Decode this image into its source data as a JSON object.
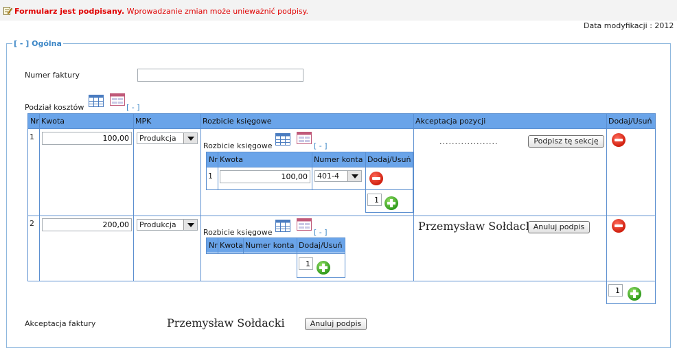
{
  "banner": {
    "bold_text": "Formularz jest podpisany.",
    "text": " Wprowadzanie zmian może unieważnić podpisy."
  },
  "modified_label": "Data modyfikacji : 2012",
  "section": {
    "toggle": "[ - ]",
    "title": "Ogólna"
  },
  "invoice": {
    "label": "Numer faktury",
    "value": ""
  },
  "cost_split": {
    "label": "Podział kosztów",
    "toggle": "[ - ]",
    "columns": [
      "Nr",
      "Kwota",
      "MPK",
      "Rozbicie księgowe",
      "Akceptacja pozycji",
      "Dodaj/Usuń"
    ],
    "rows": [
      {
        "nr": "1",
        "amount": "100,00",
        "mpk": "Produkcja",
        "breakdown": {
          "label": "Rozbicie księgowe",
          "toggle": "[ - ]",
          "columns": [
            "Nr",
            "Kwota",
            "Numer konta",
            "Dodaj/Usuń"
          ],
          "rows": [
            {
              "nr": "1",
              "amount": "100,00",
              "account": "401-4"
            }
          ],
          "add_count": "1"
        },
        "acceptance": {
          "dots": "...................",
          "button": "Podpisz tę sekcję"
        }
      },
      {
        "nr": "2",
        "amount": "200,00",
        "mpk": "Produkcja",
        "breakdown": {
          "label": "Rozbicie księgowe",
          "toggle": "[ - ]",
          "columns": [
            "Nr",
            "Kwota",
            "Numer konta",
            "Dodaj/Usuń"
          ],
          "rows": [],
          "add_count": "1"
        },
        "acceptance": {
          "signature": "Przemysław Sołdacki",
          "button": "Anuluj podpis"
        }
      }
    ],
    "add_count": "1"
  },
  "invoice_acceptance": {
    "label": "Akceptacja faktury",
    "signature": "Przemysław Sołdacki",
    "button": "Anuluj podpis"
  },
  "colors": {
    "header": "#6aa4e9",
    "border": "#5b8fd0",
    "alert": "#e00000",
    "link": "#3b86c6"
  }
}
